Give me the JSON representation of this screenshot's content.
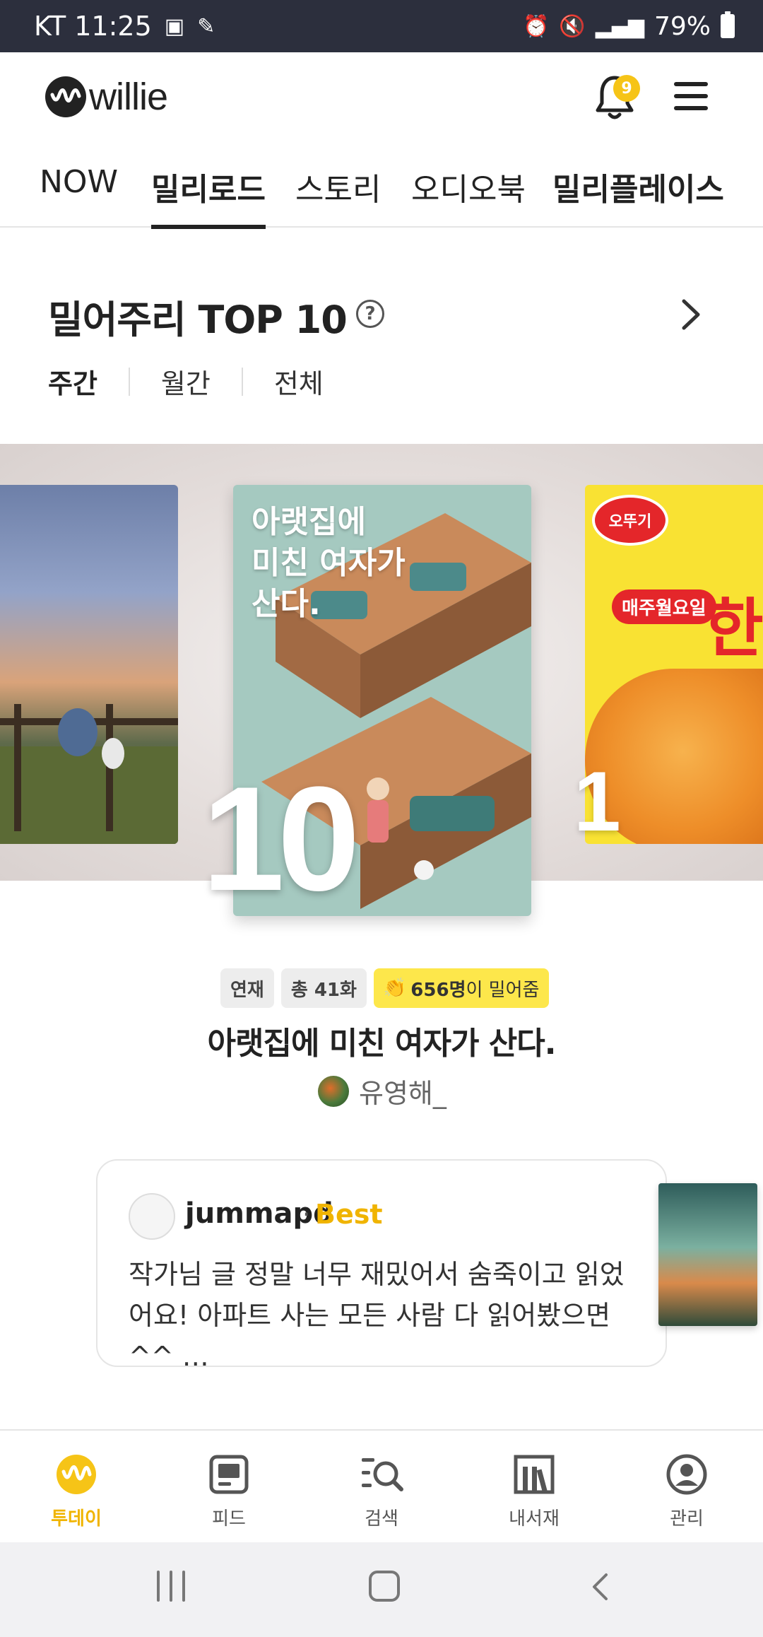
{
  "status_bar": {
    "carrier_time": "KT 11:25",
    "battery": "79%"
  },
  "header": {
    "logo": "willie",
    "notification_count": "9"
  },
  "tabs": [
    {
      "label": "NOW"
    },
    {
      "label": "밀리로드"
    },
    {
      "label": "스토리"
    },
    {
      "label": "오디오북"
    },
    {
      "label": "밀리플레이스"
    }
  ],
  "section": {
    "title": "밀어주리 TOP 10",
    "help": "?",
    "periods": [
      "주간",
      "월간",
      "전체"
    ]
  },
  "carousel": {
    "center_cover_text": "아랫집에\n미친 여자가\n산다.",
    "center_rank": "10",
    "right_rank": "1",
    "right_brand": "오뚜기",
    "right_tag": "매주월요일",
    "right_big": "한"
  },
  "book": {
    "badge_serial": "연재",
    "badge_episodes": "총 41화",
    "badge_supporters_count": "656명",
    "badge_supporters_suffix": "이 밀어줌",
    "title": "아랫집에 미친 여자가 산다.",
    "author": "유영해_"
  },
  "review": {
    "user": "jummapd",
    "dot": "·",
    "tag": "Best",
    "text": "작가님 글 정말 너무 재밌어서 숨죽이고 읽었어요! 아파트 사는 모든 사람 다 읽어봤으면^^ …"
  },
  "bottom_nav": [
    {
      "label": "투데이",
      "icon": "today-icon"
    },
    {
      "label": "피드",
      "icon": "feed-icon"
    },
    {
      "label": "검색",
      "icon": "search-icon"
    },
    {
      "label": "내서재",
      "icon": "library-icon"
    },
    {
      "label": "관리",
      "icon": "profile-icon"
    }
  ],
  "colors": {
    "accent": "#f6c417",
    "status_bar": "#2c2f3d"
  }
}
